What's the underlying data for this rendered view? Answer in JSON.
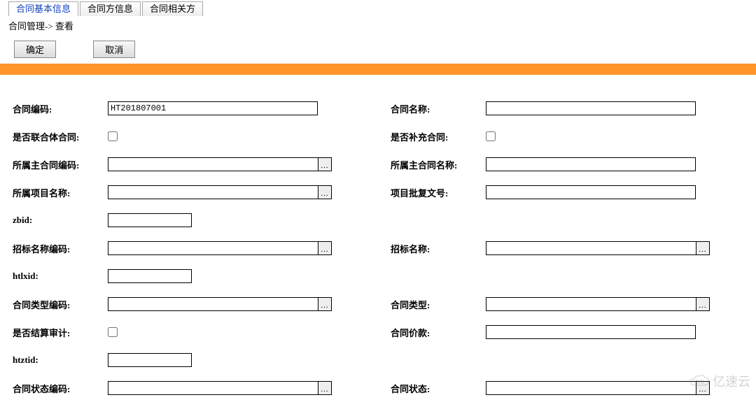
{
  "tabs": {
    "t0": "合同基本信息",
    "t1": "合同方信息",
    "t2": "合同相关方"
  },
  "breadcrumb": "合同管理-> 查看",
  "buttons": {
    "ok": "确定",
    "cancel": "取消"
  },
  "labels": {
    "htbm": "合同编码:",
    "htmc": "合同名称:",
    "sflhtht": "是否联合体合同:",
    "sfbcht": "是否补充合同:",
    "sszhtbm": "所属主合同编码:",
    "sszhtmc": "所属主合同名称:",
    "ssxmmc": "所属项目名称:",
    "xmpfwh": "项目批复文号:",
    "zbid": "zbid:",
    "zbmcbm": "招标名称编码:",
    "zbmc": "招标名称:",
    "htlxid": "htlxid:",
    "htlxbm": "合同类型编码:",
    "htlx": "合同类型:",
    "sfjssj": "是否结算审计:",
    "htjk": "合同价款:",
    "htztid": "htztid:",
    "htztbm": "合同状态编码:",
    "htzt": "合同状态:"
  },
  "values": {
    "htbm": "HT201807001",
    "htmc": "",
    "sszhtbm": "",
    "sszhtmc": "",
    "ssxmmc": "",
    "xmpfwh": "",
    "zbid": "",
    "zbmcbm": "",
    "zbmc": "",
    "htlxid": "",
    "htlxbm": "",
    "htlx": "",
    "htjk": "",
    "htztid": "",
    "htztbm": "",
    "htzt": ""
  },
  "lookup_icon": "...",
  "watermark": "亿速云"
}
